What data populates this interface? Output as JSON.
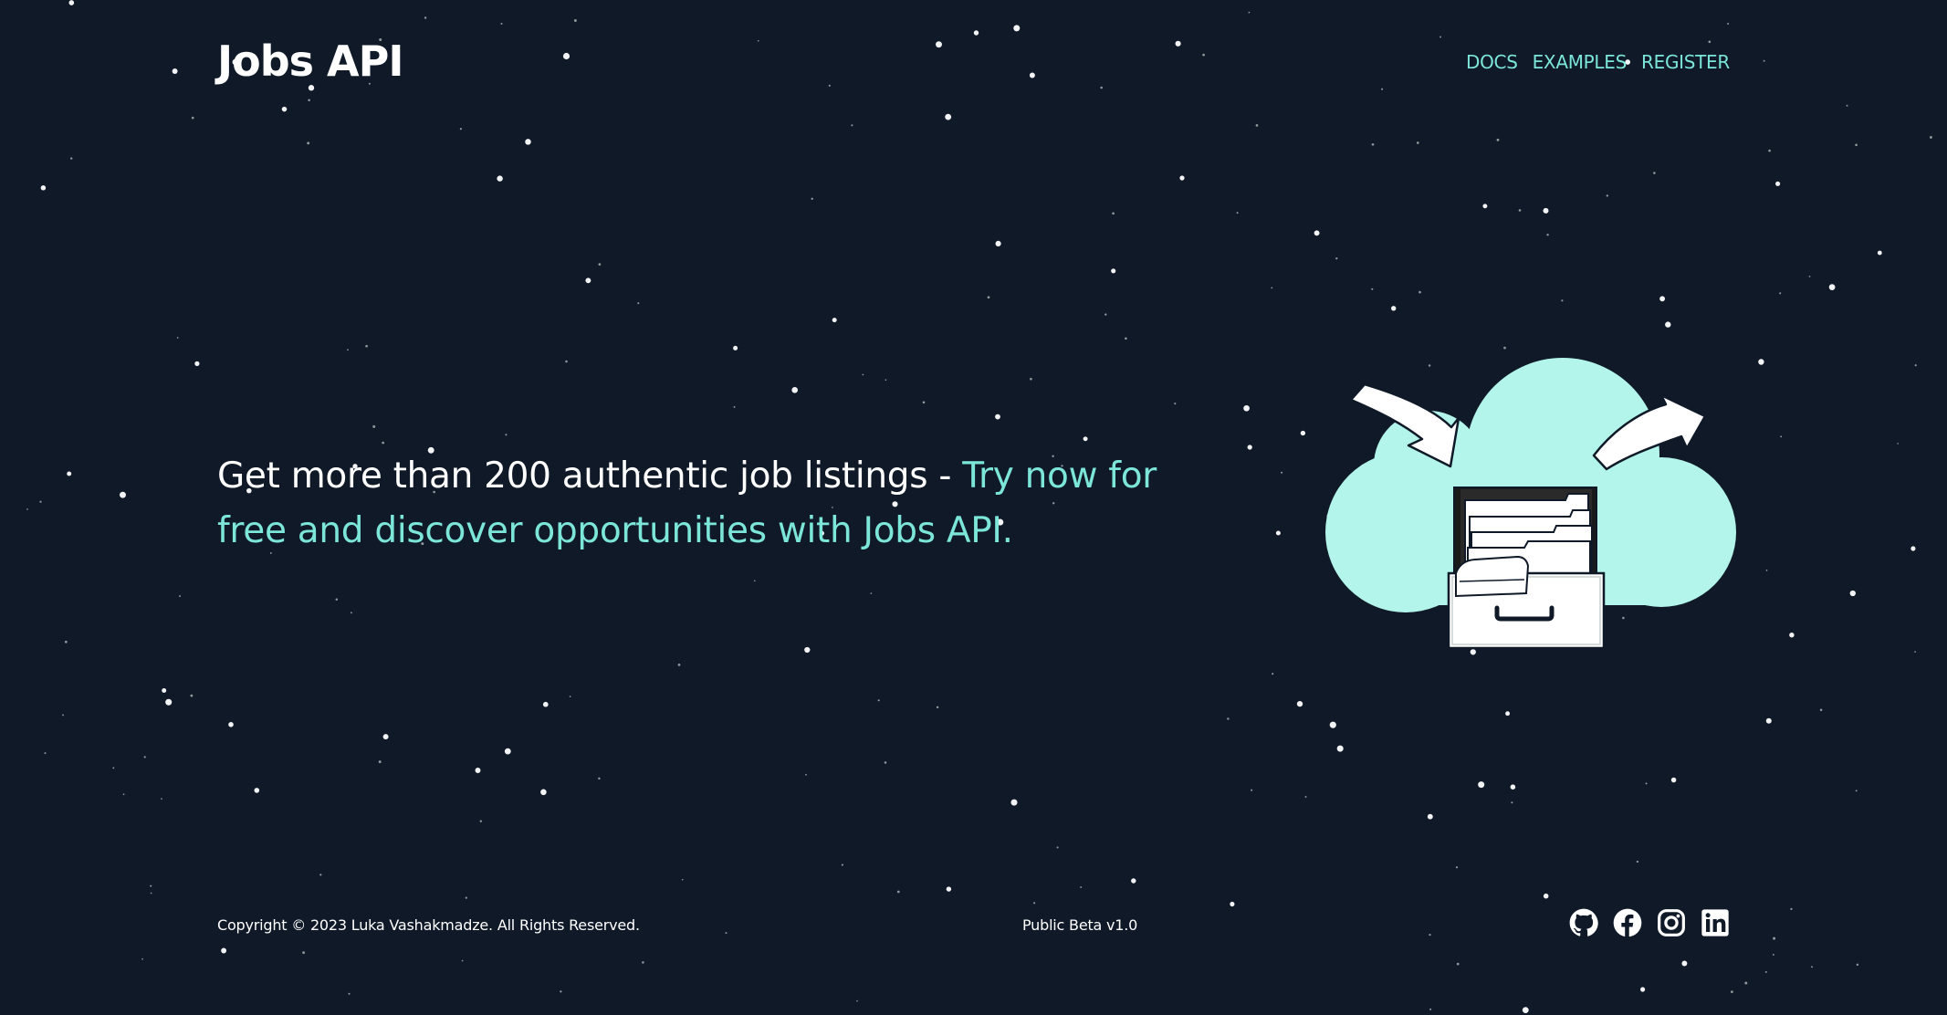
{
  "header": {
    "logo": "Jobs API",
    "nav": [
      {
        "label": "DOCS"
      },
      {
        "label": "EXAMPLES"
      },
      {
        "label": "REGISTER"
      }
    ]
  },
  "hero": {
    "text_plain": "Get more than 200 authentic job listings - ",
    "text_accent": "Try now for free and discover opportunities with Jobs API."
  },
  "footer": {
    "copyright": "Copyright © 2023 Luka Vashakmadze. All Rights Reserved.",
    "version": "Public Beta v1.0",
    "socials": [
      "github-icon",
      "facebook-icon",
      "instagram-icon",
      "linkedin-icon"
    ]
  },
  "colors": {
    "background": "#0f1928",
    "accent": "#7ce6d9",
    "cloud": "#b3f5ea",
    "text": "#ffffff"
  }
}
